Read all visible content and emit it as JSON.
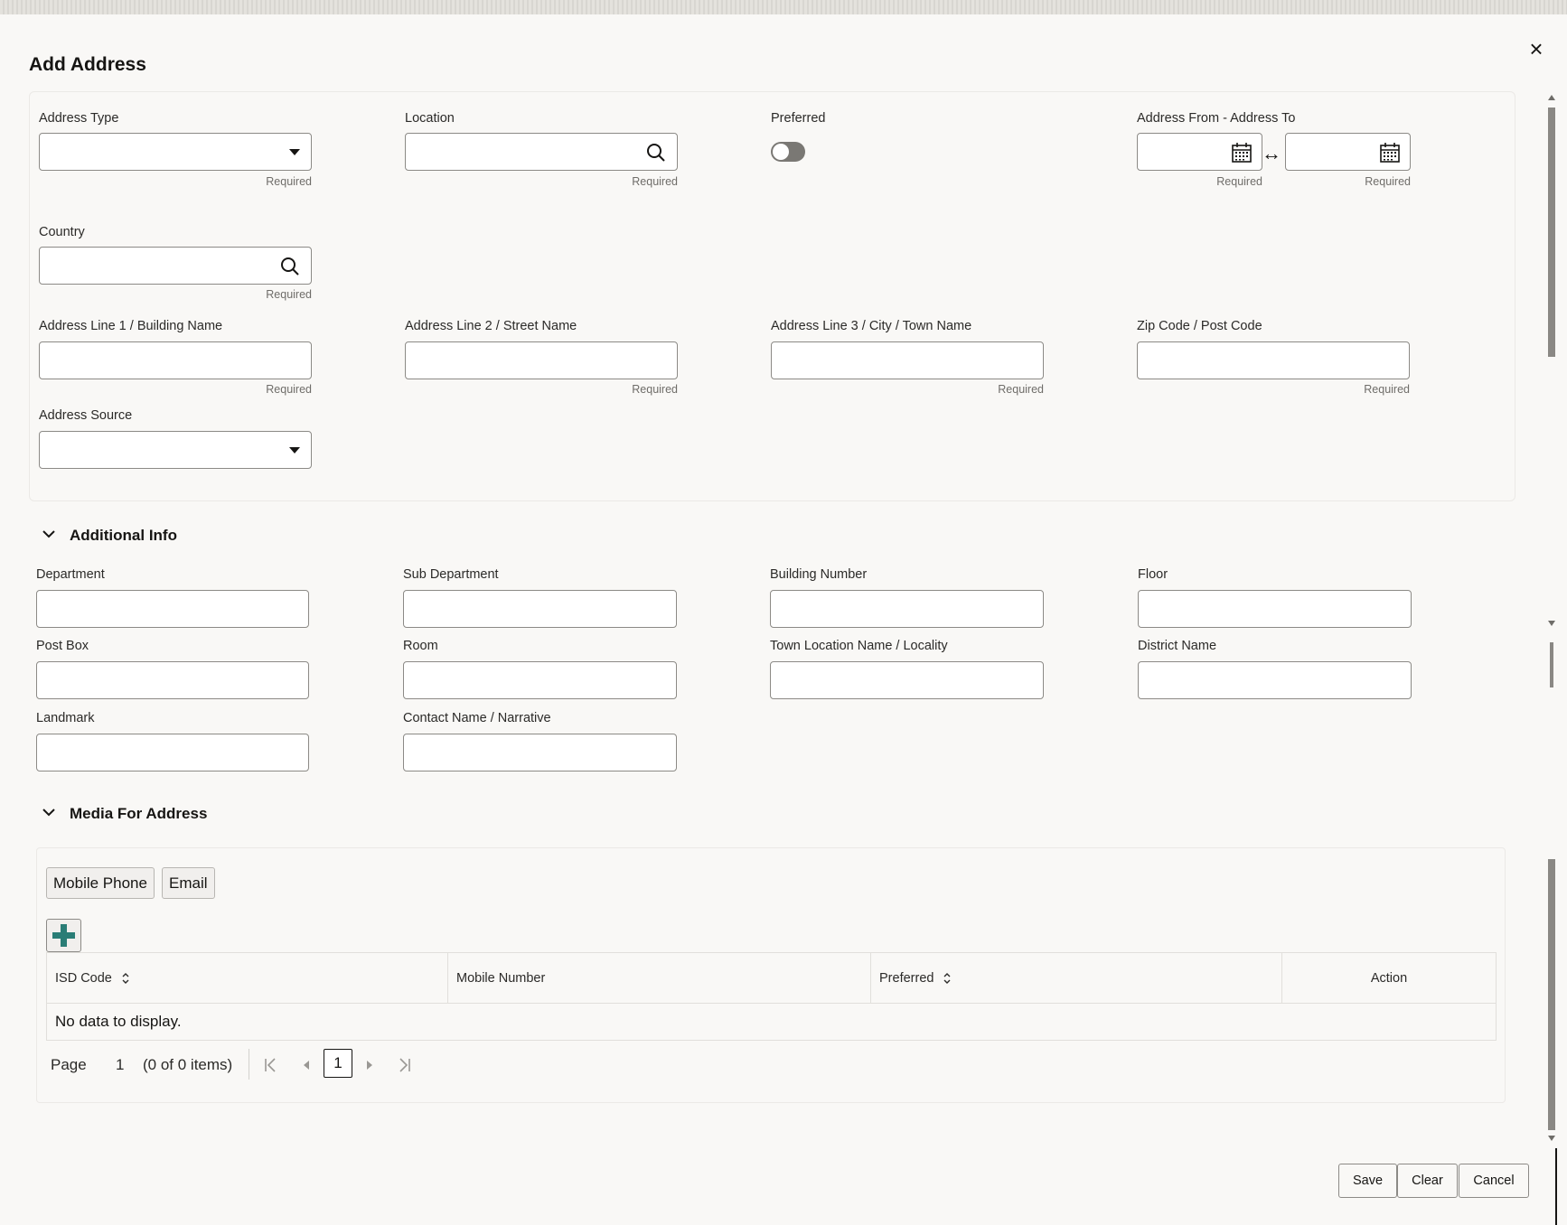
{
  "dialog": {
    "title": "Add Address",
    "close_label": "×"
  },
  "required_text": "Required",
  "fields": {
    "address_type": {
      "label": "Address Type",
      "value": ""
    },
    "location": {
      "label": "Location",
      "value": ""
    },
    "preferred": {
      "label": "Preferred",
      "on": false
    },
    "address_from_to": {
      "label": "Address From - Address To",
      "from_value": "",
      "to_value": "",
      "range_symbol": "↔"
    },
    "country": {
      "label": "Country",
      "value": ""
    },
    "address_line1": {
      "label": "Address Line 1 / Building Name",
      "value": ""
    },
    "address_line2": {
      "label": "Address Line 2 / Street Name",
      "value": ""
    },
    "address_line3": {
      "label": "Address Line 3 / City / Town Name",
      "value": ""
    },
    "zip_code": {
      "label": "Zip Code / Post Code",
      "value": ""
    },
    "address_source": {
      "label": "Address Source",
      "value": ""
    }
  },
  "additional_info": {
    "title": "Additional Info",
    "fields": {
      "department": "Department",
      "sub_department": "Sub Department",
      "building_number": "Building Number",
      "floor": "Floor",
      "post_box": "Post Box",
      "room": "Room",
      "town_location": "Town Location Name / Locality",
      "district_name": "District Name",
      "landmark": "Landmark",
      "contact_name": "Contact Name / Narrative"
    }
  },
  "media": {
    "title": "Media For Address",
    "tabs": [
      "Mobile Phone",
      "Email"
    ],
    "table": {
      "columns": [
        "ISD Code",
        "Mobile Number",
        "Preferred",
        "Action"
      ],
      "empty_text": "No data to display."
    },
    "pager": {
      "page_label": "Page",
      "page_value": "1",
      "items_text": "(0 of 0 items)",
      "current_page": "1"
    }
  },
  "footer": {
    "save": "Save",
    "clear": "Clear",
    "cancel": "Cancel"
  },
  "colors": {
    "accent_plus": "#2a7d76",
    "background": "#f9f8f6"
  }
}
